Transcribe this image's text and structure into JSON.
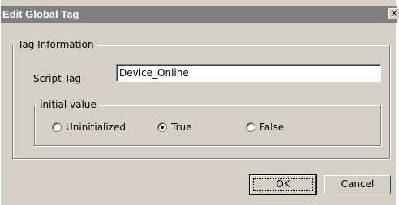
{
  "dialog": {
    "title": "Edit Global Tag",
    "close_glyph": "×"
  },
  "tag_info": {
    "legend": "Tag Information",
    "script_tag_label": "Script Tag",
    "script_tag_value": "Device_Online"
  },
  "initial_value": {
    "legend": "Initial value",
    "options": [
      {
        "label": "Uninitialized",
        "checked": false
      },
      {
        "label": "True",
        "checked": true
      },
      {
        "label": "False",
        "checked": false
      }
    ]
  },
  "buttons": {
    "ok_label": "OK",
    "cancel_label": "Cancel"
  }
}
